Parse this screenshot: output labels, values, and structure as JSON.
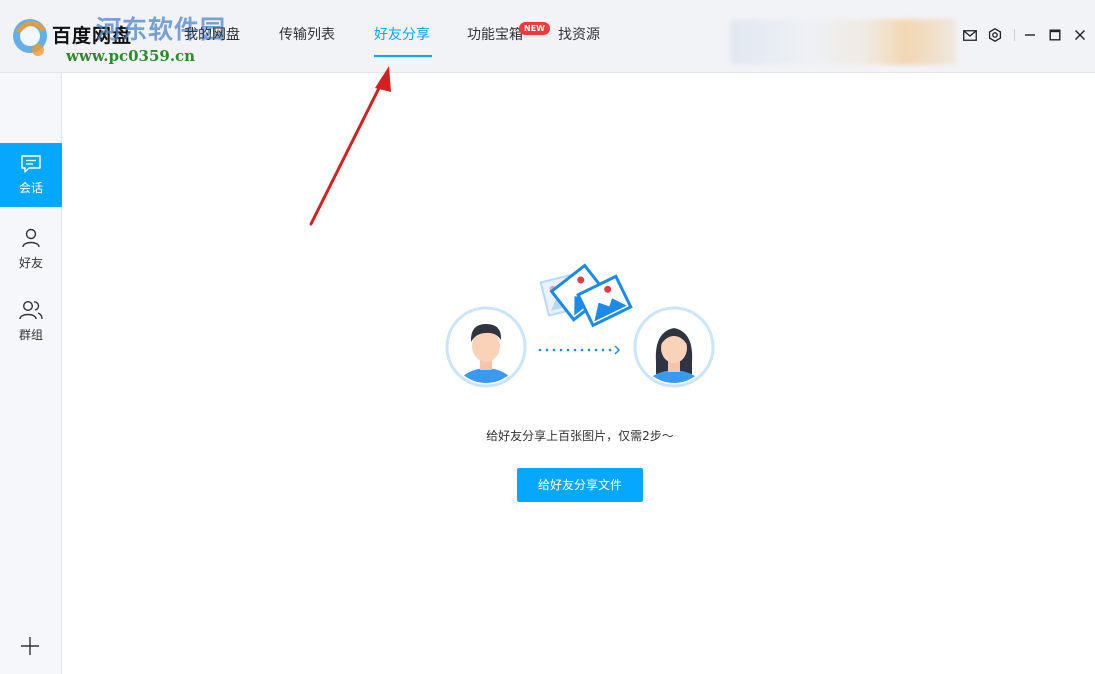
{
  "app": {
    "title": "百度网盘"
  },
  "watermark": {
    "title": "河东软件园",
    "url": "www.pc0359.cn"
  },
  "nav": {
    "tabs": [
      {
        "label": "我的网盘"
      },
      {
        "label": "传输列表"
      },
      {
        "label": "好友分享",
        "active": true
      },
      {
        "label": "功能宝箱",
        "badge": "NEW"
      },
      {
        "label": "找资源"
      }
    ]
  },
  "toolbar": {
    "icons": [
      "mail-icon",
      "settings-icon",
      "minimize-icon",
      "maximize-icon",
      "close-icon"
    ]
  },
  "sidebar": {
    "items": [
      {
        "label": "会话",
        "icon": "chat-icon",
        "active": true
      },
      {
        "label": "好友",
        "icon": "user-icon"
      },
      {
        "label": "群组",
        "icon": "group-icon"
      }
    ],
    "add_icon": "plus-icon"
  },
  "main": {
    "message": "给好友分享上百张图片，仅需2步～",
    "button_label": "给好友分享文件"
  },
  "colors": {
    "accent": "#06a7ff",
    "badge": "#f5383a",
    "annotation_arrow": "#d61f1f"
  }
}
